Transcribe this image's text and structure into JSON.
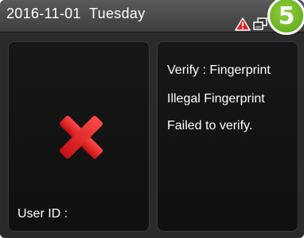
{
  "status_bar": {
    "date": "2016-11-01",
    "weekday": "Tuesday",
    "step_badge": "5",
    "icons": [
      "warning-icon",
      "network-icon"
    ]
  },
  "left_panel": {
    "result_icon": "red-cross-icon",
    "user_id_label": "User ID :"
  },
  "right_panel": {
    "messages": [
      "Verify : Fingerprint",
      "Illegal Fingerprint",
      "Failed to verify."
    ]
  },
  "colors": {
    "badge": "#6cb82a",
    "cross": "#e02020",
    "warning": "#e02020"
  }
}
